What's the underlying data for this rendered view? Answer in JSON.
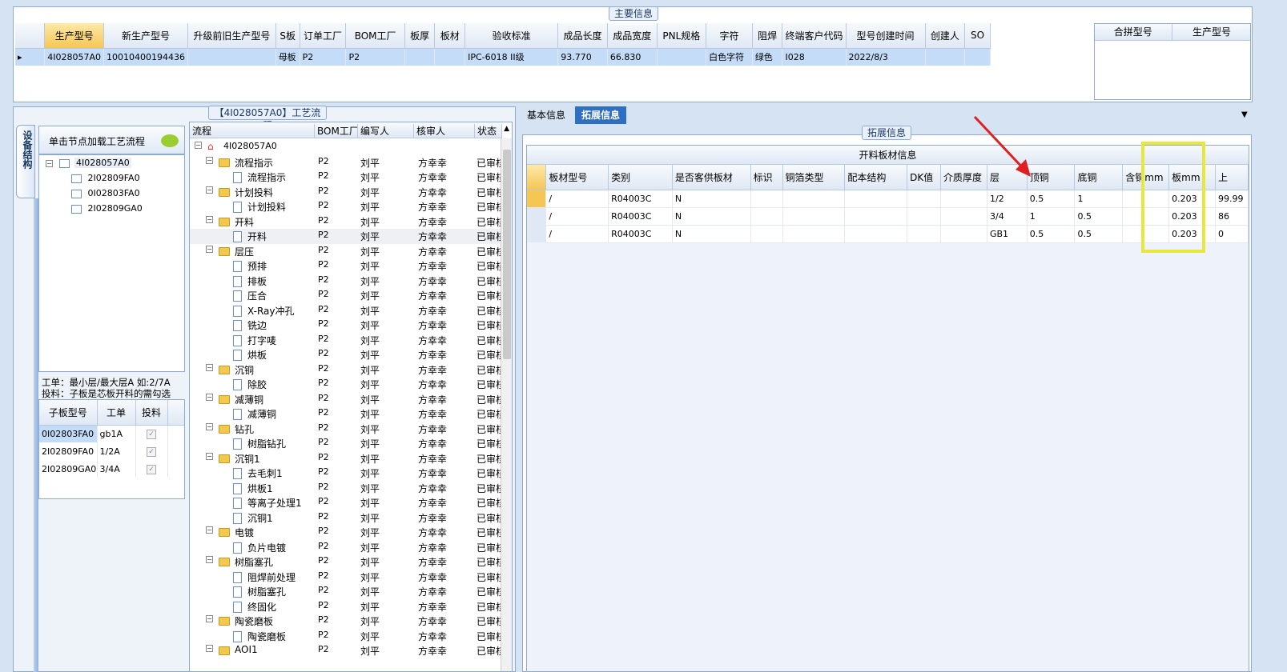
{
  "top_panel": {
    "title": "主要信息",
    "columns": [
      "生产型号",
      "新生产型号",
      "升级前旧生产型号",
      "S板",
      "订单工厂",
      "BOM工厂",
      "板厚",
      "板材",
      "验收标准",
      "成品长度",
      "成品宽度",
      "PNL规格",
      "字符",
      "阻焊",
      "终端客户代码",
      "型号创建时间",
      "创建人",
      "SO"
    ],
    "row": [
      "4I028057A0",
      "10010400194436",
      "",
      "母板",
      "P2",
      "P2",
      "",
      "",
      "IPC-6018 II级",
      "93.770",
      "66.830",
      "",
      "白色字符",
      "绿色",
      "I028",
      "2022/8/3",
      "",
      ""
    ],
    "merge_columns": [
      "合拼型号",
      "生产型号"
    ]
  },
  "flow_panel": {
    "title": "【4I028057A0】工艺流程",
    "side_tab": "设备结构",
    "load_hint": "单击节点加载工艺流程",
    "tree_nodes": [
      "4I028057A0",
      "2I02809FA0",
      "0I02803FA0",
      "2I02809GA0"
    ],
    "notes": [
      "工单：最小层/最大层A 如:2/7A",
      "投料：子板是芯板开料的需勾选"
    ],
    "sub_columns": [
      "子板型号",
      "工单",
      "投料"
    ],
    "sub_rows": [
      {
        "model": "0I02803FA0",
        "order": "gb1A",
        "check": "✓"
      },
      {
        "model": "2I02809FA0",
        "order": "1/2A",
        "check": "✓"
      },
      {
        "model": "2I02809GA0",
        "order": "3/4A",
        "check": "✓"
      }
    ]
  },
  "process": {
    "columns": [
      "流程",
      "BOM工厂",
      "编写人",
      "核审人",
      "状态"
    ],
    "root": "4I028057A0",
    "rows": [
      {
        "name": "流程指示",
        "level": 1,
        "type": "folder",
        "factory": "P2",
        "writer": "刘平",
        "reviewer": "方幸幸",
        "status": "已审核"
      },
      {
        "name": "流程指示",
        "level": 2,
        "type": "doc",
        "factory": "P2",
        "writer": "刘平",
        "reviewer": "方幸幸",
        "status": "已审核"
      },
      {
        "name": "计划投料",
        "level": 1,
        "type": "folder",
        "factory": "P2",
        "writer": "刘平",
        "reviewer": "方幸幸",
        "status": "已审核"
      },
      {
        "name": "计划投料",
        "level": 2,
        "type": "doc",
        "factory": "P2",
        "writer": "刘平",
        "reviewer": "方幸幸",
        "status": "已审核"
      },
      {
        "name": "开料",
        "level": 1,
        "type": "folder",
        "factory": "P2",
        "writer": "刘平",
        "reviewer": "方幸幸",
        "status": "已审核"
      },
      {
        "name": "开料",
        "level": 2,
        "type": "doc",
        "factory": "P2",
        "writer": "刘平",
        "reviewer": "方幸幸",
        "status": "已审核"
      },
      {
        "name": "层压",
        "level": 1,
        "type": "folder",
        "factory": "P2",
        "writer": "刘平",
        "reviewer": "方幸幸",
        "status": "已审核"
      },
      {
        "name": "预排",
        "level": 2,
        "type": "doc",
        "factory": "P2",
        "writer": "刘平",
        "reviewer": "方幸幸",
        "status": "已审核"
      },
      {
        "name": "排板",
        "level": 2,
        "type": "doc",
        "factory": "P2",
        "writer": "刘平",
        "reviewer": "方幸幸",
        "status": "已审核"
      },
      {
        "name": "压合",
        "level": 2,
        "type": "doc",
        "factory": "P2",
        "writer": "刘平",
        "reviewer": "方幸幸",
        "status": "已审核"
      },
      {
        "name": "X-Ray冲孔",
        "level": 2,
        "type": "doc",
        "factory": "P2",
        "writer": "刘平",
        "reviewer": "方幸幸",
        "status": "已审核"
      },
      {
        "name": "铣边",
        "level": 2,
        "type": "doc",
        "factory": "P2",
        "writer": "刘平",
        "reviewer": "方幸幸",
        "status": "已审核"
      },
      {
        "name": "打字唛",
        "level": 2,
        "type": "doc",
        "factory": "P2",
        "writer": "刘平",
        "reviewer": "方幸幸",
        "status": "已审核"
      },
      {
        "name": "烘板",
        "level": 2,
        "type": "doc",
        "factory": "P2",
        "writer": "刘平",
        "reviewer": "方幸幸",
        "status": "已审核"
      },
      {
        "name": "沉铜",
        "level": 1,
        "type": "folder",
        "factory": "P2",
        "writer": "刘平",
        "reviewer": "方幸幸",
        "status": "已审核"
      },
      {
        "name": "除胶",
        "level": 2,
        "type": "doc",
        "factory": "P2",
        "writer": "刘平",
        "reviewer": "方幸幸",
        "status": "已审核"
      },
      {
        "name": "减薄铜",
        "level": 1,
        "type": "folder",
        "factory": "P2",
        "writer": "刘平",
        "reviewer": "方幸幸",
        "status": "已审核"
      },
      {
        "name": "减薄铜",
        "level": 2,
        "type": "doc",
        "factory": "P2",
        "writer": "刘平",
        "reviewer": "方幸幸",
        "status": "已审核"
      },
      {
        "name": "钻孔",
        "level": 1,
        "type": "folder",
        "factory": "P2",
        "writer": "刘平",
        "reviewer": "方幸幸",
        "status": "已审核"
      },
      {
        "name": "树脂钻孔",
        "level": 2,
        "type": "doc",
        "factory": "P2",
        "writer": "刘平",
        "reviewer": "方幸幸",
        "status": "已审核"
      },
      {
        "name": "沉铜1",
        "level": 1,
        "type": "folder",
        "factory": "P2",
        "writer": "刘平",
        "reviewer": "方幸幸",
        "status": "已审核"
      },
      {
        "name": "去毛刺1",
        "level": 2,
        "type": "doc",
        "factory": "P2",
        "writer": "刘平",
        "reviewer": "方幸幸",
        "status": "已审核"
      },
      {
        "name": "烘板1",
        "level": 2,
        "type": "doc",
        "factory": "P2",
        "writer": "刘平",
        "reviewer": "方幸幸",
        "status": "已审核"
      },
      {
        "name": "等离子处理1",
        "level": 2,
        "type": "doc",
        "factory": "P2",
        "writer": "刘平",
        "reviewer": "方幸幸",
        "status": "已审核"
      },
      {
        "name": "沉铜1",
        "level": 2,
        "type": "doc",
        "factory": "P2",
        "writer": "刘平",
        "reviewer": "方幸幸",
        "status": "已审核"
      },
      {
        "name": "电镀",
        "level": 1,
        "type": "folder",
        "factory": "P2",
        "writer": "刘平",
        "reviewer": "方幸幸",
        "status": "已审核"
      },
      {
        "name": "负片电镀",
        "level": 2,
        "type": "doc",
        "factory": "P2",
        "writer": "刘平",
        "reviewer": "方幸幸",
        "status": "已审核"
      },
      {
        "name": "树脂塞孔",
        "level": 1,
        "type": "folder",
        "factory": "P2",
        "writer": "刘平",
        "reviewer": "方幸幸",
        "status": "已审核"
      },
      {
        "name": "阻焊前处理",
        "level": 2,
        "type": "doc",
        "factory": "P2",
        "writer": "刘平",
        "reviewer": "方幸幸",
        "status": "已审核"
      },
      {
        "name": "树脂塞孔",
        "level": 2,
        "type": "doc",
        "factory": "P2",
        "writer": "刘平",
        "reviewer": "方幸幸",
        "status": "已审核"
      },
      {
        "name": "终固化",
        "level": 2,
        "type": "doc",
        "factory": "P2",
        "writer": "刘平",
        "reviewer": "方幸幸",
        "status": "已审核"
      },
      {
        "name": "陶瓷磨板",
        "level": 1,
        "type": "folder",
        "factory": "P2",
        "writer": "刘平",
        "reviewer": "方幸幸",
        "status": "已审核"
      },
      {
        "name": "陶瓷磨板",
        "level": 2,
        "type": "doc",
        "factory": "P2",
        "writer": "刘平",
        "reviewer": "方幸幸",
        "status": "已审核"
      },
      {
        "name": "AOI1",
        "level": 1,
        "type": "folder",
        "factory": "P2",
        "writer": "刘平",
        "reviewer": "方幸幸",
        "status": "已审核"
      }
    ]
  },
  "detail": {
    "tabs": [
      "基本信息",
      "拓展信息"
    ],
    "group_title": "拓展信息",
    "table_title": "开料板材信息",
    "columns": [
      "板材型号",
      "类别",
      "是否客供板材",
      "标识",
      "铜箔类型",
      "配本结构",
      "DK值",
      "介质厚度",
      "层",
      "顶铜",
      "底铜",
      "含铜mm",
      "板mm",
      "上"
    ],
    "rows": [
      [
        "/",
        "R04003C",
        "N",
        "",
        "",
        "",
        "",
        "",
        "1/2",
        "0.5",
        "1",
        "",
        "0.203",
        "99.99"
      ],
      [
        "/",
        "R04003C",
        "N",
        "",
        "",
        "",
        "",
        "",
        "3/4",
        "1",
        "0.5",
        "",
        "0.203",
        "86"
      ],
      [
        "/",
        "R04003C",
        "N",
        "",
        "",
        "",
        "",
        "",
        "GB1",
        "0.5",
        "0.5",
        "",
        "0.203",
        "0"
      ]
    ]
  },
  "colors": {
    "highlight_box": "#e8e83a",
    "arrow": "#e02020",
    "tab_active": "#2f6fc2"
  }
}
